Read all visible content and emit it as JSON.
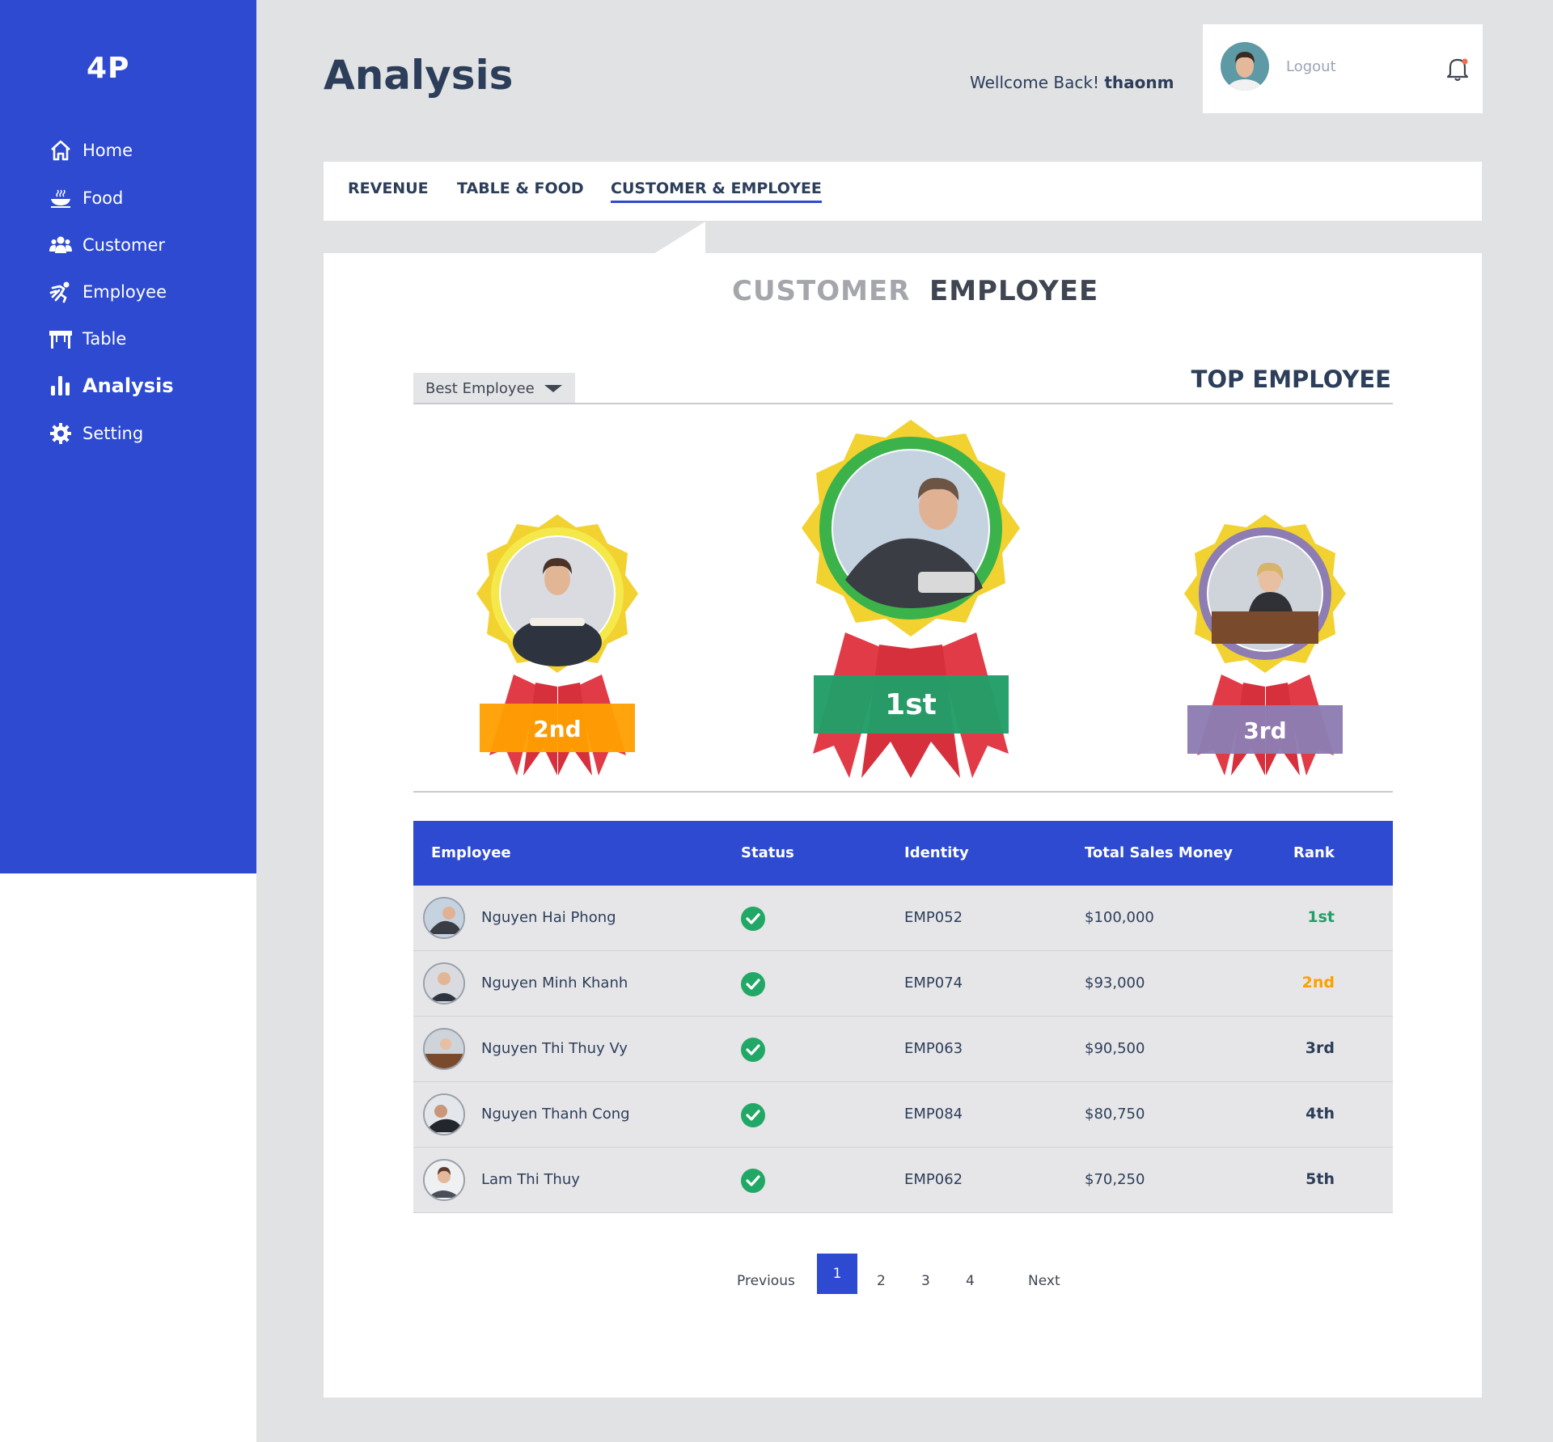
{
  "app": {
    "logo": "4P"
  },
  "sidebar": {
    "items": [
      {
        "label": "Home",
        "icon": "home-icon"
      },
      {
        "label": "Food",
        "icon": "food-icon"
      },
      {
        "label": "Customer",
        "icon": "customer-icon"
      },
      {
        "label": "Employee",
        "icon": "employee-icon"
      },
      {
        "label": "Table",
        "icon": "table-icon"
      },
      {
        "label": "Analysis",
        "icon": "analysis-icon"
      },
      {
        "label": "Setting",
        "icon": "gear-icon"
      }
    ],
    "active": "Analysis"
  },
  "header": {
    "title": "Analysis",
    "welcome_text": "Wellcome Back!",
    "username": "thaonm",
    "logout_label": "Logout"
  },
  "tabs": [
    {
      "label": "REVENUE"
    },
    {
      "label": "TABLE & FOOD"
    },
    {
      "label": "CUSTOMER & EMPLOYEE"
    }
  ],
  "subtabs": {
    "customer": "CUSTOMER",
    "employee": "EMPLOYEE"
  },
  "filter": {
    "selected": "Best Employee"
  },
  "section_title": "TOP EMPLOYEE",
  "medals": {
    "first": "1st",
    "second": "2nd",
    "third": "3rd"
  },
  "colors": {
    "brand": "#2d4ad1",
    "gold": "#f2d230",
    "first": "#229e68",
    "second": "#ff9f00",
    "third": "#8d7db2",
    "ribbon": "#e23b48"
  },
  "table": {
    "headers": [
      "Employee",
      "Status",
      "Identity",
      "Total Sales Money",
      "Rank"
    ],
    "rows": [
      {
        "name": "Nguyen Hai Phong",
        "identity": "EMP052",
        "sales": "$100,000",
        "rank": "1st"
      },
      {
        "name": "Nguyen Minh Khanh",
        "identity": "EMP074",
        "sales": "$93,000",
        "rank": "2nd"
      },
      {
        "name": "Nguyen Thi Thuy Vy",
        "identity": "EMP063",
        "sales": "$90,500",
        "rank": "3rd"
      },
      {
        "name": "Nguyen Thanh Cong",
        "identity": "EMP084",
        "sales": "$80,750",
        "rank": "4th"
      },
      {
        "name": "Lam Thi Thuy",
        "identity": "EMP062",
        "sales": "$70,250",
        "rank": "5th"
      }
    ]
  },
  "pagination": {
    "previous": "Previous",
    "pages": [
      "1",
      "2",
      "3",
      "4"
    ],
    "current": "1",
    "next": "Next"
  }
}
